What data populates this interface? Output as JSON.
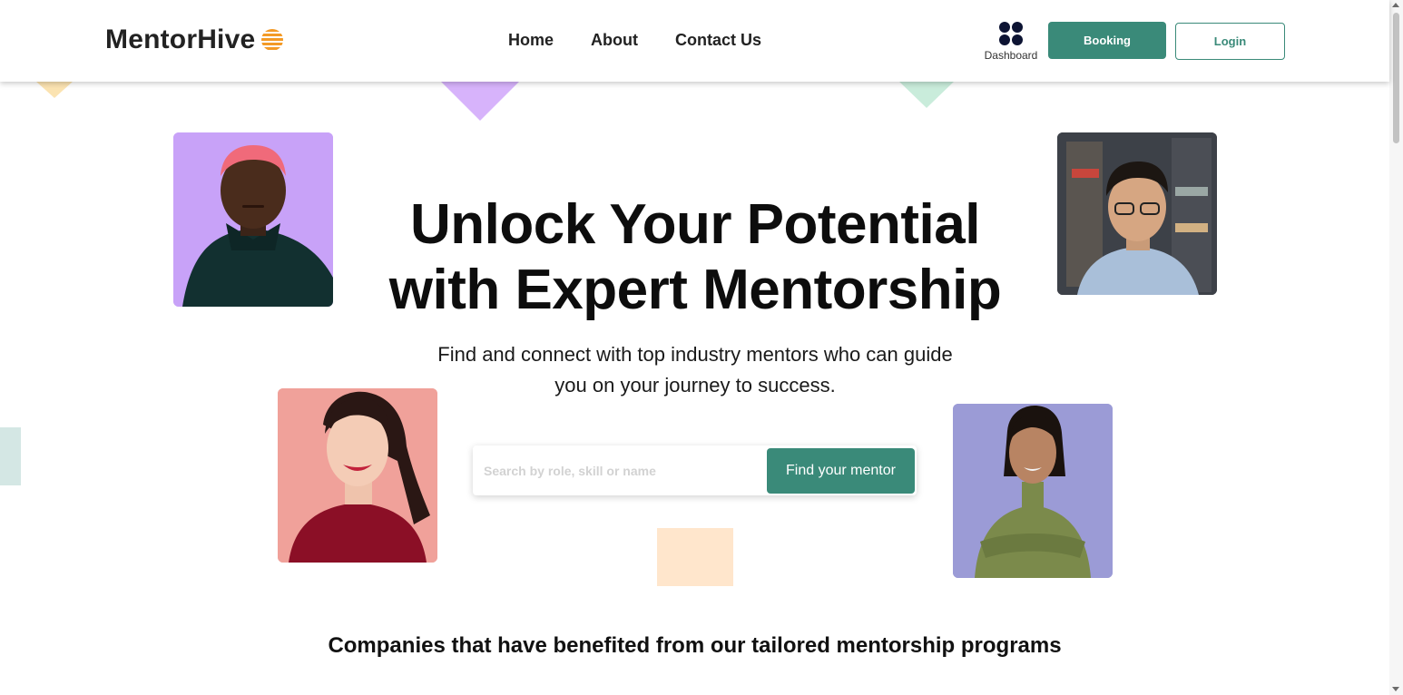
{
  "brand": {
    "name": "MentorHive",
    "icon": "striped-orange-globe-icon",
    "accent": "#f39a26"
  },
  "nav": {
    "items": [
      {
        "label": "Home"
      },
      {
        "label": "About"
      },
      {
        "label": "Contact Us"
      }
    ]
  },
  "header_actions": {
    "dashboard_label": "Dashboard",
    "dashboard_icon": "four-dots-grid-icon",
    "booking_label": "Booking",
    "login_label": "Login"
  },
  "hero": {
    "title_line1": "Unlock Your Potential",
    "title_line2": "with Expert Mentorship",
    "subtitle_line1": "Find and connect with top industry mentors who can guide",
    "subtitle_line2": "you on your journey to success."
  },
  "search": {
    "placeholder": "Search by role, skill or name",
    "button_label": "Find your mentor"
  },
  "companies": {
    "title": "Companies that have benefited from our tailored mentorship programs"
  },
  "colors": {
    "primary": "#3a8a79",
    "purple_shape": "#d7b3fb",
    "yellow_shape": "#fbe3b1",
    "green_shape": "#c9ecdb",
    "peach_shape": "#ffe6cc",
    "teal_shape": "#d4e7e4"
  }
}
